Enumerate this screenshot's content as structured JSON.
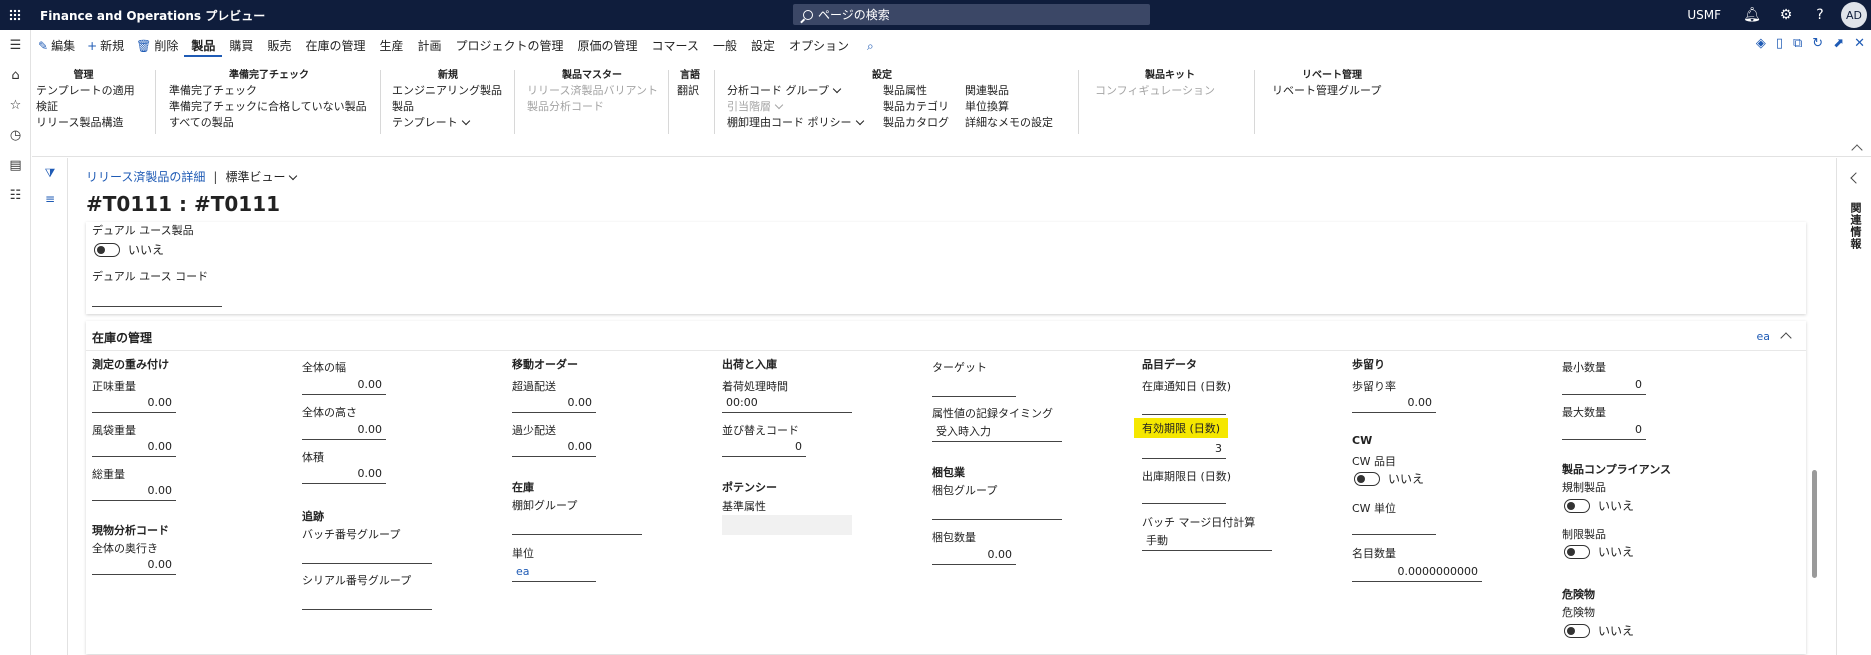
{
  "app": {
    "title": "Finance and Operations プレビュー",
    "search_placeholder": "ページの検索",
    "company": "USMF",
    "avatar_initials": "AD"
  },
  "actionpane": {
    "commands": {
      "edit": "編集",
      "new": "新規",
      "delete": "削除"
    },
    "tabs": [
      "製品",
      "購買",
      "販売",
      "在庫の管理",
      "生産",
      "計画",
      "プロジェクトの管理",
      "原価の管理",
      "コマース",
      "一般",
      "設定",
      "オプション"
    ],
    "selected_tab": "製品",
    "groups": {
      "manage": {
        "title": "管理",
        "items": [
          "テンプレートの適用",
          "検証",
          "リリース製品構造"
        ]
      },
      "readiness": {
        "title": "準備完了チェック",
        "items": [
          "準備完了チェック",
          "準備完了チェックに合格していない製品",
          "すべての製品"
        ]
      },
      "new": {
        "title": "新規",
        "items": [
          "エンジニアリング製品",
          "製品",
          "テンプレート"
        ]
      },
      "product_master": {
        "title": "製品マスター",
        "items": [
          "リリース済製品バリアント",
          "製品分析コード"
        ]
      },
      "language": {
        "title": "言語",
        "items": [
          "翻訳"
        ]
      },
      "setup": {
        "title": "設定",
        "items": [
          "分析コード グループ",
          "引当階層",
          "棚卸理由コード ポリシー",
          "製品属性",
          "製品カテゴリ",
          "製品カタログ",
          "関連製品",
          "単位換算",
          "詳細なメモの設定"
        ]
      },
      "kit": {
        "title": "製品キット",
        "items": [
          "コンフィギュレーション"
        ]
      },
      "rebate": {
        "title": "リベート管理",
        "items": [
          "リベート管理グループ"
        ]
      }
    }
  },
  "page": {
    "breadcrumb": "リリース済製品の詳細",
    "view": "標準ビュー",
    "title": "#T0111 : #T0111"
  },
  "dual_use": {
    "product_label": "デュアル ユース製品",
    "product_value": "いいえ",
    "code_label": "デュアル ユース コード",
    "code_value": ""
  },
  "inventory": {
    "title": "在庫の管理",
    "summary": "ea",
    "weights": {
      "head": "測定の重み付け",
      "net_label": "正味重量",
      "net": "0.00",
      "tare_label": "風袋重量",
      "tare": "0.00",
      "gross_label": "総重量",
      "gross": "0.00"
    },
    "physical": {
      "head": "現物分析コード",
      "depth_label": "全体の奥行き",
      "depth": "0.00"
    },
    "dims": {
      "width_label": "全体の幅",
      "width": "0.00",
      "height_label": "全体の高さ",
      "height": "0.00",
      "volume_label": "体積",
      "volume": "0.00"
    },
    "tracking": {
      "head": "追跡",
      "batch_label": "バッチ番号グループ",
      "batch": "",
      "serial_label": "シリアル番号グループ",
      "serial": ""
    },
    "transfer": {
      "head": "移動オーダー",
      "over_label": "超過配送",
      "over": "0.00",
      "under_label": "過少配送",
      "under": "0.00"
    },
    "stock": {
      "head": "在庫",
      "count_group_label": "棚卸グループ",
      "count_group": "",
      "unit_label": "単位",
      "unit": "ea"
    },
    "inout": {
      "head": "出荷と入庫",
      "arrival_label": "着荷処理時間",
      "arrival": "00:00",
      "sort_label": "並び替えコード",
      "sort": "0"
    },
    "potency": {
      "head": "ポテンシー",
      "base_attr_label": "基準属性",
      "base_attr": ""
    },
    "target": {
      "label": "ターゲット",
      "value": "",
      "timing_label": "属性値の記録タイミング",
      "timing": "受入時入力"
    },
    "packing": {
      "head": "梱包業",
      "group_label": "梱包グループ",
      "group": "",
      "qty_label": "梱包数量",
      "qty": "0.00"
    },
    "item_data": {
      "head": "品目データ",
      "notice_label": "在庫通知日 (日数)",
      "notice": "",
      "shelf_label": "有効期限 (日数)",
      "shelf": "3",
      "best_before_label": "出庫期限日 (日数)",
      "best_before": "",
      "batch_merge_label": "バッチ マージ日付計算",
      "batch_merge": "手動"
    },
    "yield": {
      "head": "歩留り",
      "pct_label": "歩留り率",
      "pct": "0.00"
    },
    "cw": {
      "head": "CW",
      "item_label": "CW 品目",
      "item": "いいえ",
      "unit_label": "CW 単位",
      "unit": "",
      "nominal_label": "名目数量",
      "nominal": "0.0000000000"
    },
    "qty": {
      "min_label": "最小数量",
      "min": "0",
      "max_label": "最大数量",
      "max": "0"
    },
    "compliance": {
      "head": "製品コンプライアンス",
      "regulated_label": "規制製品",
      "regulated": "いいえ",
      "restricted_label": "制限製品",
      "restricted": "いいえ"
    },
    "hazard": {
      "head": "危険物",
      "hazard_label": "危険物",
      "hazard": "いいえ"
    }
  },
  "related_info": "関連情報",
  "colors": {
    "topbar": "#0f1d3c",
    "accent": "#1f5bb5",
    "highlight": "#f5e700"
  }
}
